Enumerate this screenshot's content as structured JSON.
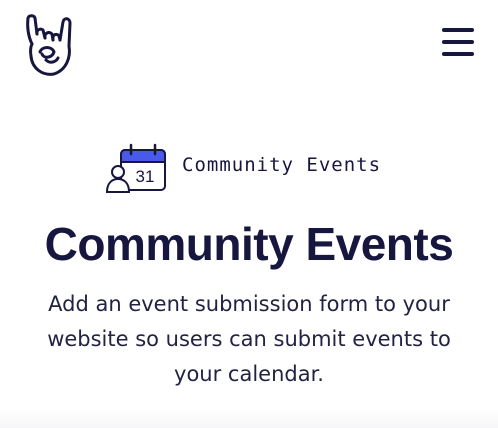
{
  "header": {
    "logo_icon": "rock-hand-icon",
    "menu_icon": "hamburger-menu-icon"
  },
  "eyebrow": {
    "icon": "calendar-user-icon",
    "calendar_day": "31",
    "label": "Community Events"
  },
  "hero": {
    "title": "Community Events",
    "description": "Add an event submission form to your website so users can submit events to your calendar."
  },
  "colors": {
    "text": "#16163f",
    "accent": "#4a5ae8"
  }
}
